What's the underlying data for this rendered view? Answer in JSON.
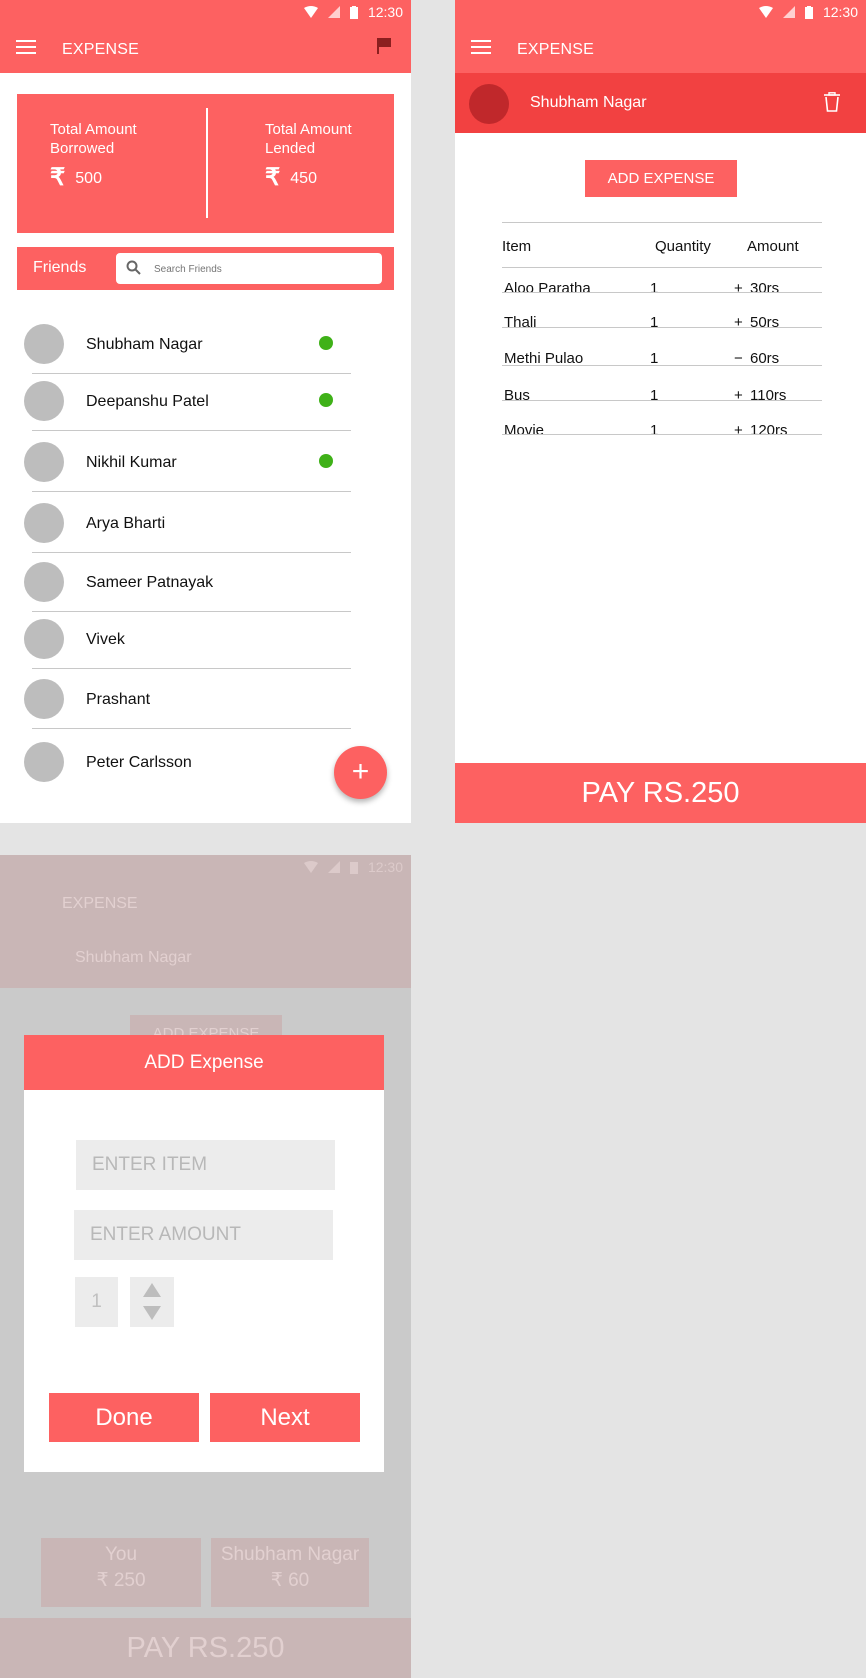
{
  "status": {
    "time": "12:30"
  },
  "app": {
    "title": "EXPENSE"
  },
  "home": {
    "borrowed": {
      "label": "Total Amount Borrowed",
      "currency_symbol": "₹",
      "value": "500"
    },
    "lended": {
      "label": "Total Amount Lended",
      "currency_symbol": "₹",
      "value": "450"
    },
    "friends_label": "Friends",
    "search_placeholder": "Search Friends",
    "friends": [
      {
        "name": "Shubham Nagar",
        "online": true
      },
      {
        "name": "Deepanshu Patel",
        "online": true
      },
      {
        "name": "Nikhil Kumar",
        "online": true
      },
      {
        "name": "Arya Bharti",
        "online": false
      },
      {
        "name": "Sameer Patnayak",
        "online": false
      },
      {
        "name": "Vivek",
        "online": false
      },
      {
        "name": "Prashant",
        "online": false
      },
      {
        "name": "Peter Carlsson",
        "online": false
      }
    ],
    "fab_label": "+"
  },
  "detail": {
    "friend_name": "Shubham Nagar",
    "add_button": "ADD EXPENSE",
    "columns": [
      "Item",
      "Quantity",
      "Amount"
    ],
    "rows": [
      {
        "item": "Aloo Paratha",
        "quantity": "1",
        "sign": "+",
        "amount": "30rs"
      },
      {
        "item": "Thali",
        "quantity": "1",
        "sign": "+",
        "amount": "50rs"
      },
      {
        "item": "Methi Pulao",
        "quantity": "1",
        "sign": "−",
        "amount": "60rs"
      },
      {
        "item": "Bus",
        "quantity": "1",
        "sign": "+",
        "amount": "110rs"
      },
      {
        "item": "Movie",
        "quantity": "1",
        "sign": "+",
        "amount": "120rs"
      }
    ],
    "pay_label": "PAY RS.250"
  },
  "dialog": {
    "title": "ADD Expense",
    "item_placeholder": "ENTER ITEM",
    "amount_placeholder": "ENTER AMOUNT",
    "quantity": "1",
    "done_label": "Done",
    "next_label": "Next"
  },
  "background_screen": {
    "title": "EXPENSE",
    "friend_name": "Shubham Nagar",
    "add_button": "ADD EXPENSE",
    "you_label": "You",
    "you_amount": "₹ 250",
    "friend_label": "Shubham Nagar",
    "friend_amount": "₹ 60",
    "pay_label": "PAY RS.250"
  },
  "colors": {
    "primary": "#fd6161",
    "primary_dark": "#f24141",
    "online": "#3fb118",
    "canvas": "#e4e4e4"
  }
}
